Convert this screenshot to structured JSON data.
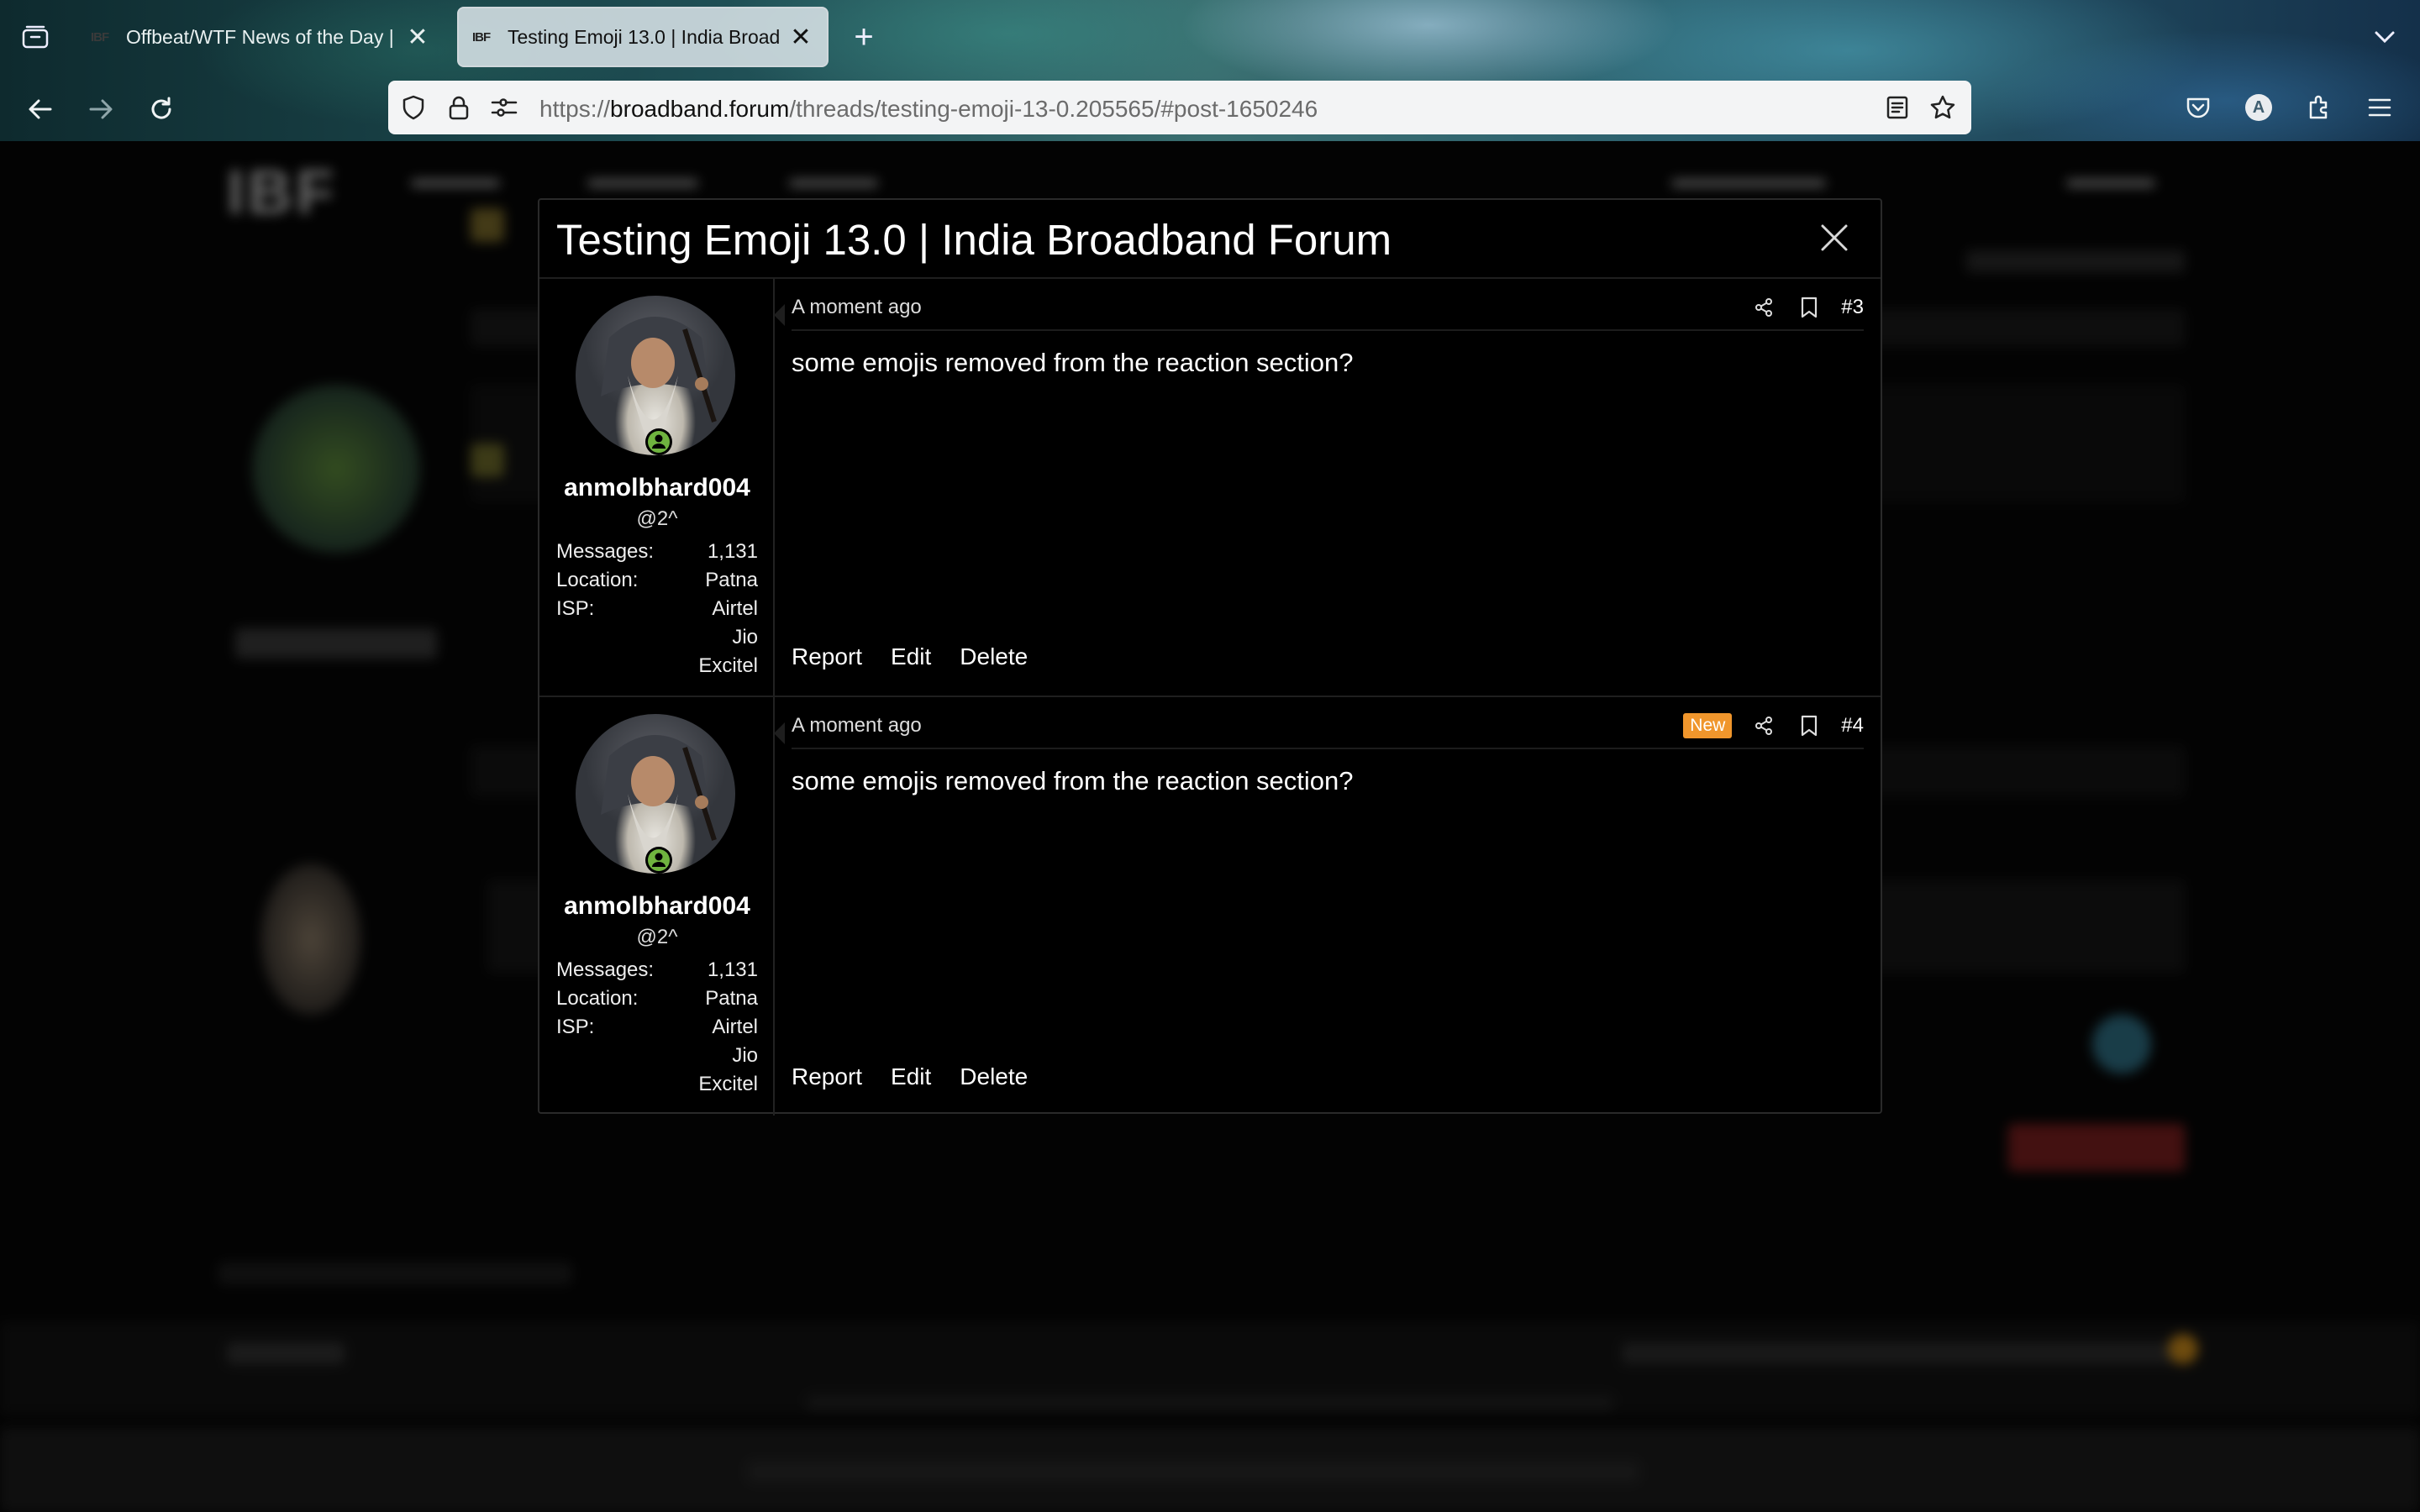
{
  "browser": {
    "tabs": [
      {
        "favicon": "IBF",
        "title": "Offbeat/WTF News of the Day | I",
        "active": false
      },
      {
        "favicon": "IBF",
        "title": "Testing Emoji 13.0 | India Broadb",
        "active": true
      }
    ],
    "url": {
      "scheme": "https://",
      "host": "broadband.forum",
      "path": "/threads/testing-emoji-13-0.205565/#post-1650246"
    },
    "profile_initial": "A",
    "icons": [
      "tabs-list-icon",
      "back-icon",
      "forward-icon",
      "reload-icon",
      "shield-icon",
      "lock-icon",
      "site-permissions-icon",
      "reader-view-icon",
      "bookmark-star-icon",
      "pocket-icon",
      "extensions-icon",
      "menu-icon"
    ]
  },
  "modal": {
    "title": "Testing Emoji 13.0 | India Broadband Forum",
    "posts": [
      {
        "time": "A moment ago",
        "number": "#3",
        "is_new": false,
        "username": "anmolbhard004",
        "user_title": "@2^",
        "stats": {
          "messages_label": "Messages:",
          "messages": "1,131",
          "location_label": "Location:",
          "location": "Patna",
          "isp_label": "ISP:",
          "isp": [
            "Airtel",
            "Jio",
            "Excitel"
          ]
        },
        "body": "some emojis removed from the reaction section?",
        "actions": {
          "report": "Report",
          "edit": "Edit",
          "delete": "Delete"
        }
      },
      {
        "time": "A moment ago",
        "number": "#4",
        "is_new": true,
        "new_label": "New",
        "username": "anmolbhard004",
        "user_title": "@2^",
        "stats": {
          "messages_label": "Messages:",
          "messages": "1,131",
          "location_label": "Location:",
          "location": "Patna",
          "isp_label": "ISP:",
          "isp": [
            "Airtel",
            "Jio",
            "Excitel"
          ]
        },
        "body": "some emojis removed from the reaction section?",
        "actions": {
          "report": "Report",
          "edit": "Edit",
          "delete": "Delete"
        }
      }
    ]
  },
  "colors": {
    "new_badge": "#f0962c",
    "online_indicator": "#6fb33f",
    "modal_bg": "#000000"
  }
}
